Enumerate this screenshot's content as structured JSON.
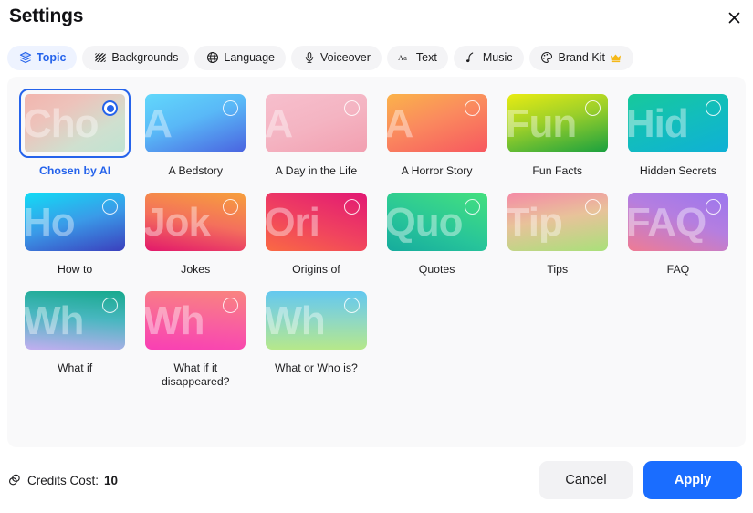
{
  "dialog": {
    "title": "Settings",
    "close_icon": "close-icon"
  },
  "tabs": [
    {
      "label": "Topic",
      "icon": "layers-icon",
      "active": true
    },
    {
      "label": "Backgrounds",
      "icon": "hatch-icon",
      "active": false
    },
    {
      "label": "Language",
      "icon": "globe-icon",
      "active": false
    },
    {
      "label": "Voiceover",
      "icon": "microphone-icon",
      "active": false
    },
    {
      "label": "Text",
      "icon": "aa-text-icon",
      "active": false
    },
    {
      "label": "Music",
      "icon": "music-note-icon",
      "active": false
    },
    {
      "label": "Brand Kit",
      "icon": "palette-icon",
      "active": false,
      "badge": "crown-icon"
    }
  ],
  "topics": [
    {
      "label": "Chosen by AI",
      "word": "Cho",
      "selected": true,
      "gradient": "linear-gradient(150deg, #f2b5ae 0%, #edc3bb 32%, #cfe0cf 70%, #bfe3d2 100%)"
    },
    {
      "label": "A Bedstory",
      "word": "A",
      "selected": false,
      "gradient": "linear-gradient(160deg, #62d8fb 0%, #59b8f7 45%, #4a63e0 100%)"
    },
    {
      "label": "A Day in the Life",
      "word": "A",
      "selected": false,
      "gradient": "linear-gradient(160deg, #f7bfcd 0%, #f4b4c2 50%, #f29fb0 100%)"
    },
    {
      "label": "A Horror Story",
      "word": "A",
      "selected": false,
      "gradient": "linear-gradient(160deg, #fbb34a 0%, #fa8a5e 45%, #f7575f 100%)"
    },
    {
      "label": "Fun Facts",
      "word": "Fun",
      "selected": false,
      "gradient": "linear-gradient(165deg, #e9ec12 0%, #9bcf2a 45%, #18a03f 100%)"
    },
    {
      "label": "Hidden Secrets",
      "word": "Hid",
      "selected": false,
      "gradient": "linear-gradient(160deg, #17c99a 0%, #12bdbd 50%, #0fb0d6 100%)"
    },
    {
      "label": "How to",
      "word": "Ho",
      "selected": false,
      "gradient": "linear-gradient(165deg, #12dcf5 0%, #3a9ae8 50%, #3b3fbd 100%)"
    },
    {
      "label": "Jokes",
      "word": "Jok",
      "selected": false,
      "gradient": "linear-gradient(190deg, #f6a03c 0%, #f4705c 50%, #e2186b 100%)"
    },
    {
      "label": "Origins of",
      "word": "Ori",
      "selected": false,
      "gradient": "linear-gradient(200deg, #e21874 0%, #f0435f 55%, #fa6a43 100%)"
    },
    {
      "label": "Quotes",
      "word": "Quo",
      "selected": false,
      "gradient": "linear-gradient(200deg, #44e07e 0%, #27c49a 60%, #16ab9d 100%)"
    },
    {
      "label": "Tips",
      "word": "Tip",
      "selected": false,
      "gradient": "linear-gradient(170deg, #f58aa6 0%, #e8c29a 45%, #a9e07a 100%)"
    },
    {
      "label": "FAQ",
      "word": "FAQ",
      "selected": false,
      "gradient": "linear-gradient(200deg, #9a76ef 0%, #b57ee0 45%, #ef7b93 100%)"
    },
    {
      "label": "What if",
      "word": "Wh",
      "selected": false,
      "gradient": "linear-gradient(185deg, #17a98d 0%, #49b7c0 45%, #c3aef0 100%)"
    },
    {
      "label": "What if it disappeared?",
      "word": "Wh",
      "selected": false,
      "gradient": "linear-gradient(185deg, #f9847f 0%, #f95fa0 55%, #f93fb4 100%)"
    },
    {
      "label": "What or Who is?",
      "word": "Wh",
      "selected": false,
      "gradient": "linear-gradient(180deg, #63c8ef 0%, #8fd8c4 50%, #b6e88a 100%)"
    }
  ],
  "footer": {
    "credits_icon": "credits-coin-icon",
    "credits_label": "Credits Cost:",
    "credits_value": "10",
    "cancel_label": "Cancel",
    "apply_label": "Apply"
  },
  "colors": {
    "accent": "#1a6dff",
    "tab_active_text": "#2563eb",
    "panel_bg": "#f9f9fa",
    "crown": "#f5b817"
  }
}
